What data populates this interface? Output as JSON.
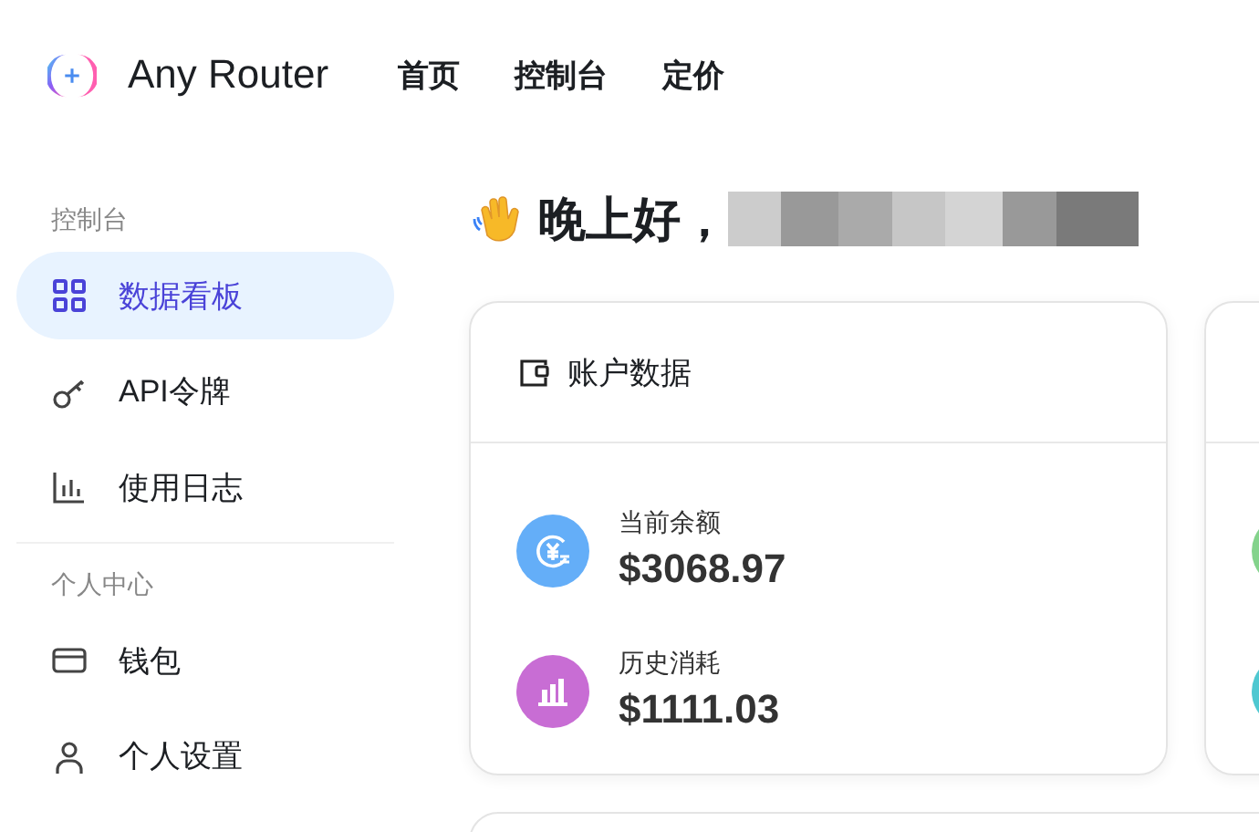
{
  "header": {
    "logo_text": "Any Router",
    "nav": [
      {
        "label": "首页"
      },
      {
        "label": "控制台"
      },
      {
        "label": "定价"
      }
    ]
  },
  "sidebar": {
    "sections": [
      {
        "title": "控制台",
        "items": [
          {
            "label": "数据看板",
            "kind": "grid",
            "selected": true
          },
          {
            "label": "API令牌",
            "kind": "key",
            "selected": false
          },
          {
            "label": "使用日志",
            "kind": "chart",
            "selected": false
          }
        ]
      },
      {
        "title": "个人中心",
        "items": [
          {
            "label": "钱包",
            "kind": "card",
            "selected": false
          },
          {
            "label": "个人设置",
            "kind": "user",
            "selected": false
          }
        ]
      }
    ]
  },
  "greeting": {
    "text": "晚上好，"
  },
  "cards": [
    {
      "title": "账户数据",
      "stats": [
        {
          "label": "当前余额",
          "value": "$3068.97",
          "kind": "balance",
          "color": "#64aef8"
        },
        {
          "label": "历史消耗",
          "value": "$1111.03",
          "kind": "usage",
          "color": "#c86dd4"
        }
      ]
    },
    {
      "stats": [
        {
          "color": "#84d38c"
        },
        {
          "color": "#4fc8d1"
        }
      ]
    }
  ]
}
